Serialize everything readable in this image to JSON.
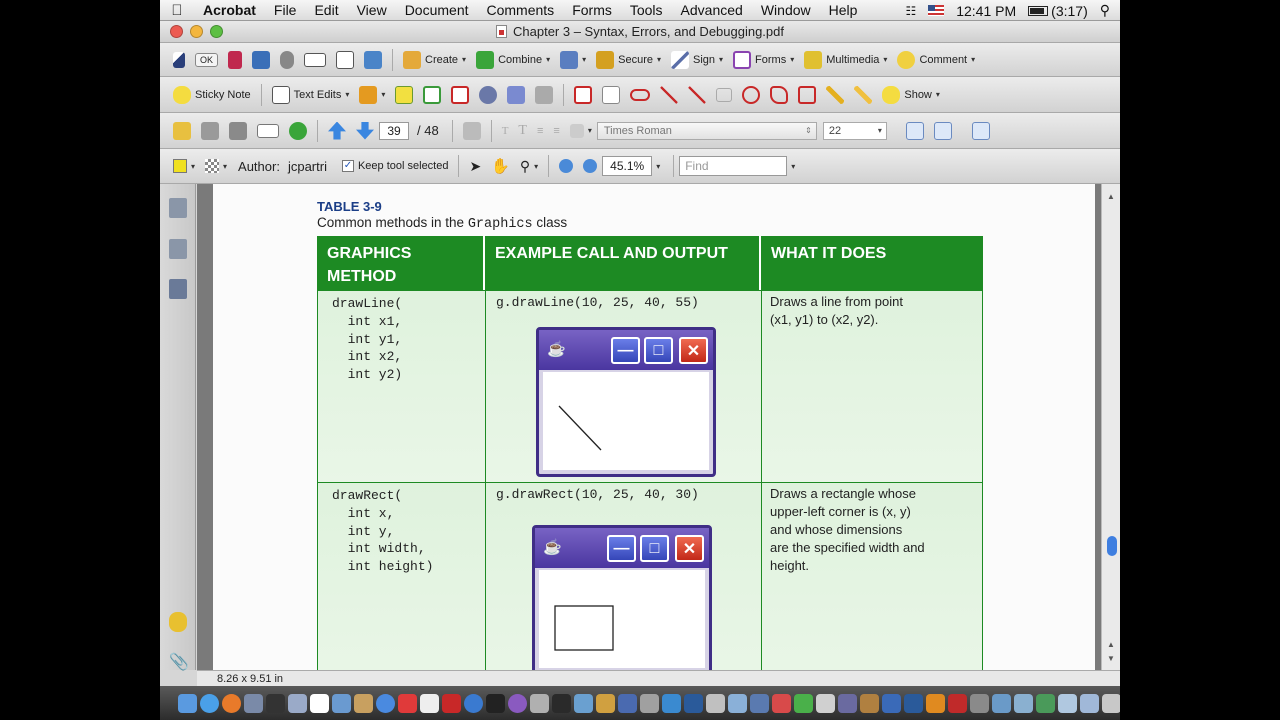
{
  "menubar": {
    "app": "Acrobat",
    "items": [
      "File",
      "Edit",
      "View",
      "Document",
      "Comments",
      "Forms",
      "Tools",
      "Advanced",
      "Window",
      "Help"
    ],
    "clock": "12:41 PM",
    "battery": "(3:17)"
  },
  "window": {
    "title": "Chapter 3 – Syntax, Errors, and Debugging.pdf"
  },
  "toolbar1": {
    "ok_label": "OK",
    "create": "Create",
    "combine": "Combine",
    "secure": "Secure",
    "sign": "Sign",
    "forms": "Forms",
    "multimedia": "Multimedia",
    "comment": "Comment"
  },
  "toolbar2": {
    "sticky_note": "Sticky Note",
    "text_edits": "Text Edits",
    "show": "Show"
  },
  "toolbar3": {
    "page_current": "39",
    "page_total": "/ 48",
    "font": "Times Roman",
    "font_size": "22"
  },
  "toolbar4": {
    "author_label": "Author:",
    "author_value": "jcpartri",
    "keep_tool": "Keep tool selected",
    "zoom": "45.1%",
    "find_placeholder": "Find"
  },
  "document": {
    "table_title": "TABLE 3-9",
    "subtitle_pre": "Common methods in the ",
    "subtitle_code": "Graphics",
    "subtitle_post": " class",
    "headers": [
      "GRAPHICS METHOD",
      "EXAMPLE CALL AND OUTPUT",
      "WHAT IT DOES"
    ],
    "rows": [
      {
        "method": "drawLine(\n  int x1,\n  int y1,\n  int x2,\n  int y2)",
        "call": "g.drawLine(10, 25, 40, 55)",
        "desc": "Draws a line from point\n(x1, y1) to (x2, y2)."
      },
      {
        "method": "drawRect(\n  int x,\n  int y,\n  int width,\n  int height)",
        "call": "g.drawRect(10, 25, 40, 30)",
        "desc": "Draws a rectangle whose\nupper-left corner is (x, y)\nand whose dimensions\nare the specified width and\nheight."
      }
    ]
  },
  "statusbar": {
    "page_size": "8.26 x 9.51 in"
  }
}
